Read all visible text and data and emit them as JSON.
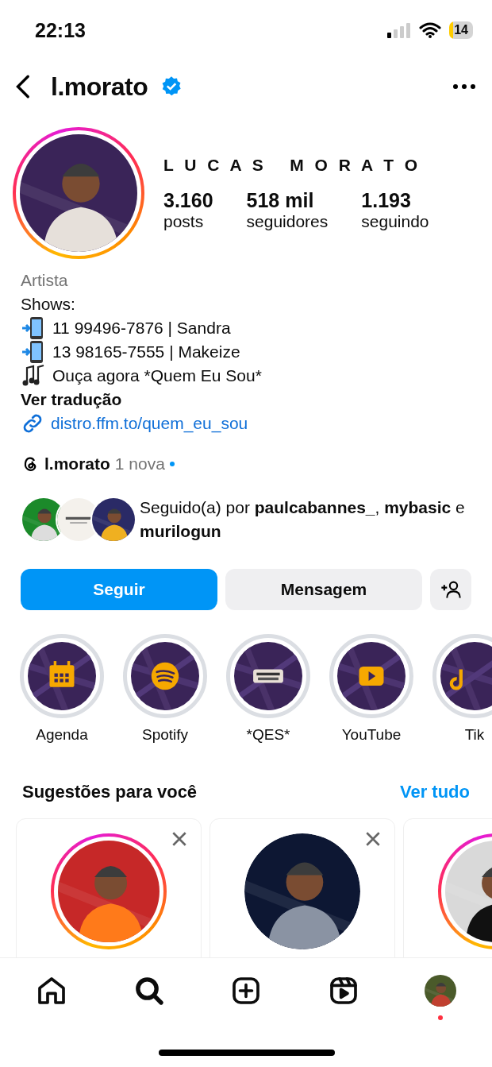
{
  "status_bar": {
    "time": "22:13",
    "battery": "14",
    "battery_low": true
  },
  "header": {
    "username": "l.morato",
    "verified": true
  },
  "profile": {
    "has_story": true,
    "full_name": "L U C A S   M O R A T O",
    "stats": [
      {
        "value": "3.160",
        "label": "posts"
      },
      {
        "value": "518 mil",
        "label": "seguidores"
      },
      {
        "value": "1.193",
        "label": "seguindo"
      }
    ]
  },
  "bio": {
    "category": "Artista",
    "lines": [
      {
        "kind": "plain",
        "text": "Shows:"
      },
      {
        "kind": "phone",
        "text": "11 99496-7876 | Sandra"
      },
      {
        "kind": "phone",
        "text": "13 98165-7555 | Makeize"
      },
      {
        "kind": "music",
        "text": "Ouça agora *Quem Eu Sou*"
      }
    ],
    "translate": "Ver tradução",
    "link": "distro.ffm.to/quem_eu_sou"
  },
  "threads": {
    "username": "l.morato",
    "badge": "1 nova",
    "unread": true
  },
  "followed_by": "Seguido(a) por **paulcabannes_**, **mybasic** e **murilogun**",
  "actions": {
    "follow": "Seguir",
    "message": "Mensagem"
  },
  "highlights": [
    {
      "kind": "calendar",
      "label": "Agenda"
    },
    {
      "kind": "spotify",
      "label": "Spotify"
    },
    {
      "kind": "sticker",
      "label": "*QES*"
    },
    {
      "kind": "youtube",
      "label": "YouTube"
    },
    {
      "kind": "tiktok",
      "label": "Tik"
    }
  ],
  "suggestions": {
    "title": "Sugestões para você",
    "see_all": "Ver tudo",
    "cards": [
      {
        "has_story": true,
        "dismissable": true
      },
      {
        "has_story": false,
        "dismissable": true
      },
      {
        "has_story": true,
        "dismissable": false
      }
    ]
  },
  "tab_bar": [
    {
      "kind": "home",
      "selected": false
    },
    {
      "kind": "search",
      "selected": true
    },
    {
      "kind": "create",
      "selected": false
    },
    {
      "kind": "reels",
      "selected": false
    },
    {
      "kind": "profile",
      "selected": false,
      "notification": true
    }
  ]
}
